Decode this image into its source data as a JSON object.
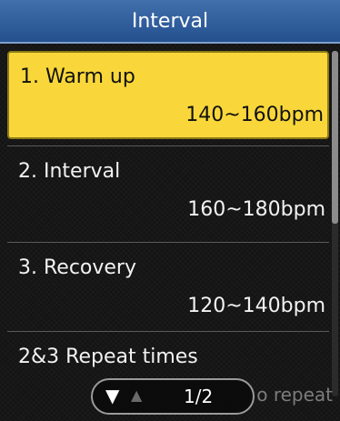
{
  "screen": {
    "title": "Interval"
  },
  "menu": {
    "items": [
      {
        "label": "1. Warm up",
        "range": "140~160bpm",
        "selected": true
      },
      {
        "label": "2. Interval",
        "range": "160~180bpm",
        "selected": false
      },
      {
        "label": "3. Recovery",
        "range": "120~140bpm",
        "selected": false
      },
      {
        "label": "2&3 Repeat times",
        "selected": false
      }
    ]
  },
  "footer": {
    "page_indicator": "1/2",
    "ghost_text": "o repeat",
    "down_icon": "triangle-down",
    "up_icon": "triangle-up"
  },
  "colors": {
    "title_bar": "#2d5a98",
    "selected_bg": "#f9d73a",
    "background": "#141414"
  }
}
